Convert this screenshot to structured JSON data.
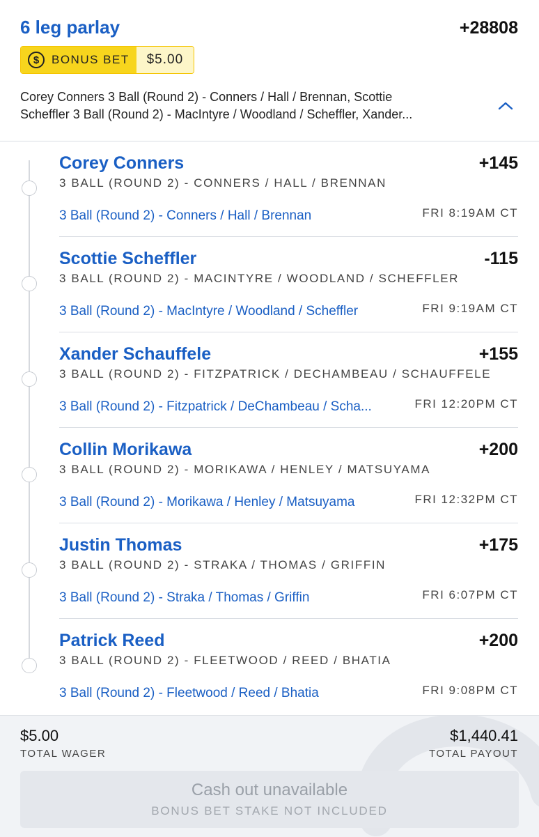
{
  "bet": {
    "title": "6 leg parlay",
    "total_odds": "+28808",
    "bonus_label": "BONUS BET",
    "bonus_amount": "$5.00",
    "summary_line1": "Corey Conners 3 Ball (Round 2) - Conners / Hall / Brennan, Scottie",
    "summary_line2": "Scheffler 3 Ball (Round 2) - MacIntyre / Woodland / Scheffler, Xander...",
    "collapse_icon": "chevron-up-icon"
  },
  "legs": [
    {
      "name": "Corey Conners",
      "odds": "+145",
      "market": "3 BALL (ROUND 2) - CONNERS / HALL / BRENNAN",
      "event": "3 Ball (Round 2) - Conners / Hall / Brennan",
      "time": "FRI 8:19AM CT"
    },
    {
      "name": "Scottie Scheffler",
      "odds": "-115",
      "market": "3 BALL (ROUND 2) - MACINTYRE / WOODLAND / SCHEFFLER",
      "event": "3 Ball (Round 2) - MacIntyre / Woodland / Scheffler",
      "time": "FRI 9:19AM CT"
    },
    {
      "name": "Xander Schauffele",
      "odds": "+155",
      "market": "3 BALL (ROUND 2) - FITZPATRICK / DECHAMBEAU / SCHAUFFELE",
      "event": "3 Ball (Round 2) - Fitzpatrick / DeChambeau / Scha...",
      "time": "FRI 12:20PM CT"
    },
    {
      "name": "Collin Morikawa",
      "odds": "+200",
      "market": "3 BALL (ROUND 2) - MORIKAWA / HENLEY / MATSUYAMA",
      "event": "3 Ball (Round 2) - Morikawa / Henley / Matsuyama",
      "time": "FRI 12:32PM CT"
    },
    {
      "name": "Justin Thomas",
      "odds": "+175",
      "market": "3 BALL (ROUND 2) - STRAKA / THOMAS / GRIFFIN",
      "event": "3 Ball (Round 2) - Straka / Thomas / Griffin",
      "time": "FRI 6:07PM CT"
    },
    {
      "name": "Patrick Reed",
      "odds": "+200",
      "market": "3 BALL (ROUND 2) - FLEETWOOD / REED / BHATIA",
      "event": "3 Ball (Round 2) - Fleetwood / Reed / Bhatia",
      "time": "FRI 9:08PM CT"
    }
  ],
  "footer": {
    "total_wager_value": "$5.00",
    "total_wager_label": "TOTAL WAGER",
    "total_payout_value": "$1,440.41",
    "total_payout_label": "TOTAL PAYOUT",
    "cash_out_title": "Cash out unavailable",
    "cash_out_subtitle": "BONUS BET STAKE NOT INCLUDED"
  },
  "colors": {
    "accent": "#1a5fc4",
    "bonus_yellow": "#f7d51d",
    "footer_bg": "#f1f3f6"
  }
}
